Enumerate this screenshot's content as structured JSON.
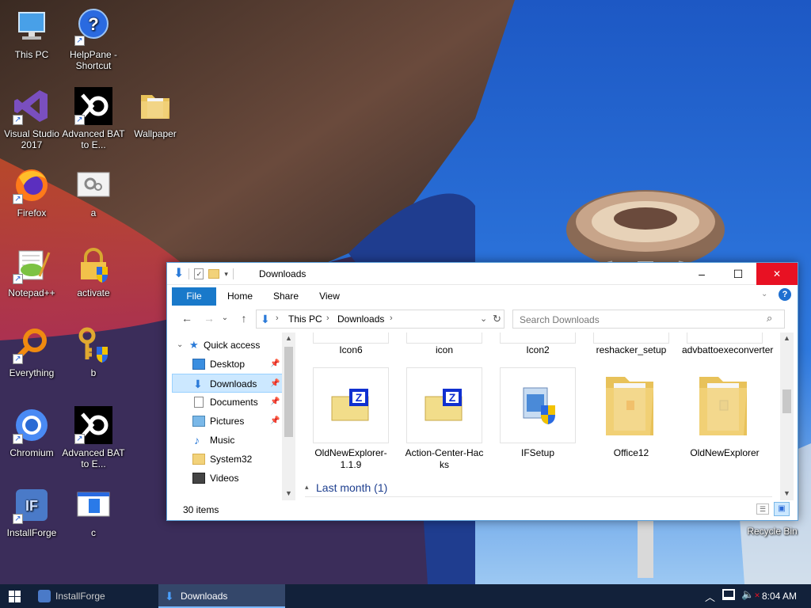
{
  "desktop": {
    "icons": [
      {
        "label": "This PC",
        "icon": "computer-icon"
      },
      {
        "label": "HelpPane - Shortcut",
        "icon": "help-icon"
      },
      {
        "label": "Visual Studio 2017",
        "icon": "visual-studio-icon"
      },
      {
        "label": "Advanced BAT to E...",
        "icon": "bat-converter-icon"
      },
      {
        "label": "Wallpaper",
        "icon": "folder-icon"
      },
      {
        "label": "Firefox",
        "icon": "firefox-icon"
      },
      {
        "label": "a",
        "icon": "settings-file-icon"
      },
      {
        "label": "Notepad++",
        "icon": "notepadpp-icon"
      },
      {
        "label": "activate",
        "icon": "lock-shield-icon"
      },
      {
        "label": "Everything",
        "icon": "magnifier-icon"
      },
      {
        "label": "b",
        "icon": "key-shield-icon"
      },
      {
        "label": "Chromium",
        "icon": "chromium-icon"
      },
      {
        "label": "Advanced BAT to E...",
        "icon": "bat-converter-icon"
      },
      {
        "label": "InstallForge",
        "icon": "installforge-icon"
      },
      {
        "label": "c",
        "icon": "window-file-icon"
      },
      {
        "label": "Recycle Bin",
        "icon": "recycle-bin-icon"
      }
    ]
  },
  "explorer": {
    "title": "Downloads",
    "title_buttons": {
      "minimize": "–",
      "maximize": "☐",
      "close": "✕"
    },
    "ribbon_tabs": [
      "File",
      "Home",
      "Share",
      "View"
    ],
    "breadcrumb": [
      "This PC",
      "Downloads"
    ],
    "search_placeholder": "Search Downloads",
    "nav": {
      "quick_access": "Quick access",
      "items": [
        {
          "label": "Desktop",
          "pinned": true
        },
        {
          "label": "Downloads",
          "pinned": true,
          "selected": true
        },
        {
          "label": "Documents",
          "pinned": true
        },
        {
          "label": "Pictures",
          "pinned": true
        },
        {
          "label": "Music",
          "pinned": false
        },
        {
          "label": "System32",
          "pinned": false
        },
        {
          "label": "Videos",
          "pinned": false
        }
      ]
    },
    "top_row": [
      "Icon6",
      "icon",
      "Icon2",
      "reshacker_setup",
      "advbattoexeconverter"
    ],
    "files": [
      {
        "name": "OldNewExplorer-1.1.9",
        "type": "archive"
      },
      {
        "name": "Action-Center-Hacks",
        "type": "archive"
      },
      {
        "name": "IFSetup",
        "type": "installer"
      },
      {
        "name": "Office12",
        "type": "folder"
      },
      {
        "name": "OldNewExplorer",
        "type": "folder"
      }
    ],
    "group_header": "Last month (1)",
    "status": "30 items"
  },
  "taskbar": {
    "tasks": [
      "InstallForge",
      "Downloads"
    ],
    "clock": "8:04 AM"
  },
  "colors": {
    "accent": "#0078d7",
    "title_bar": "#ffffff",
    "close_hover": "#e81123",
    "taskbar": "#12213a",
    "selection": "#cce8ff"
  }
}
